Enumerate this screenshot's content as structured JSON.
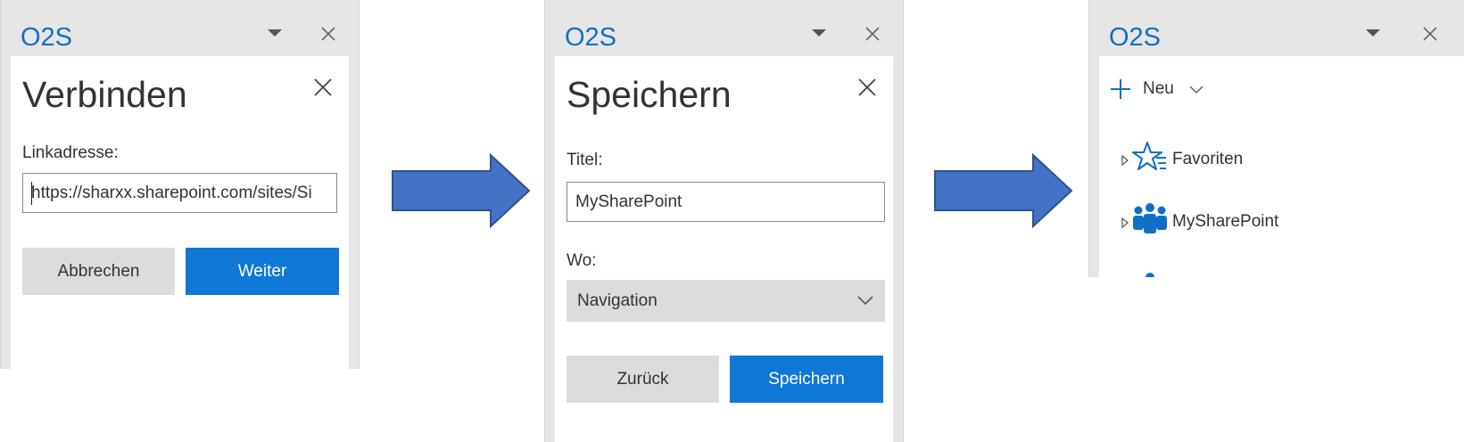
{
  "panels": [
    {
      "app_title": "O2S",
      "dialog_title": "Verbinden",
      "link_label": "Linkadresse:",
      "link_value": "https://sharxx.sharepoint.com/sites/Si",
      "cancel_label": "Abbrechen",
      "next_label": "Weiter"
    },
    {
      "app_title": "O2S",
      "dialog_title": "Speichern",
      "title_label": "Titel:",
      "title_value": "MySharePoint",
      "where_label": "Wo:",
      "where_value": "Navigation",
      "back_label": "Zurück",
      "save_label": "Speichern"
    },
    {
      "app_title": "O2S",
      "new_label": "Neu",
      "tree_items": [
        {
          "label": "Favoriten",
          "icon": "star-list-icon"
        },
        {
          "label": "MySharePoint",
          "icon": "teams-people-icon"
        }
      ]
    }
  ],
  "colors": {
    "brand": "#0f6fc6",
    "primary_button": "#0f78d7",
    "arrow_fill": "#4472c4",
    "arrow_stroke": "#2f528f",
    "pane_background": "#e6e6e6"
  }
}
